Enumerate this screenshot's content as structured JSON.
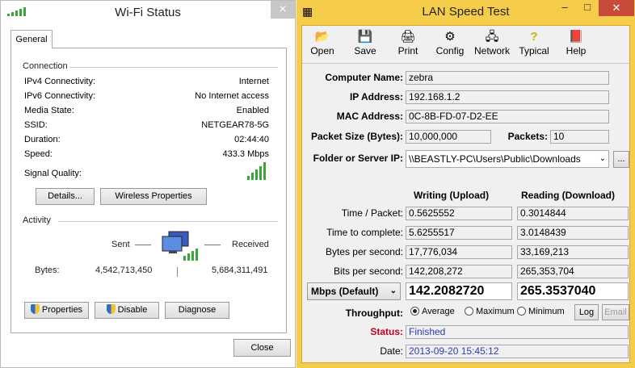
{
  "wifi": {
    "title": "Wi-Fi Status",
    "close_glyph": "×",
    "tab": "General",
    "connection": {
      "heading": "Connection",
      "rows": [
        {
          "label": "IPv4 Connectivity:",
          "value": "Internet"
        },
        {
          "label": "IPv6 Connectivity:",
          "value": "No Internet access"
        },
        {
          "label": "Media State:",
          "value": "Enabled"
        },
        {
          "label": "SSID:",
          "value": "NETGEAR78-5G"
        },
        {
          "label": "Duration:",
          "value": "02:44:40"
        },
        {
          "label": "Speed:",
          "value": "433.3 Mbps"
        }
      ],
      "signal_label": "Signal Quality:",
      "signal_bars": 5
    },
    "details_button": "Details...",
    "wireless_button": "Wireless Properties",
    "activity": {
      "heading": "Activity",
      "sent": "Sent",
      "received": "Received",
      "bytes_label": "Bytes:",
      "bytes_sent": "4,542,713,450",
      "bytes_received": "5,684,311,491"
    },
    "properties_button": "Properties",
    "disable_button": "Disable",
    "diagnose_button": "Diagnose",
    "close_button": "Close"
  },
  "lan": {
    "title": "LAN Speed Test",
    "controls": {
      "minimize": "–",
      "maximize": "□",
      "close": "✕"
    },
    "toolbar": [
      {
        "label": "Open",
        "icon": "folder-open-icon",
        "glyph": "📂"
      },
      {
        "label": "Save",
        "icon": "floppy-icon",
        "glyph": "💾"
      },
      {
        "label": "Print",
        "icon": "printer-icon",
        "glyph": "🖨"
      },
      {
        "label": "Config",
        "icon": "config-icon",
        "glyph": "⚙"
      },
      {
        "label": "Network",
        "icon": "network-icon",
        "glyph": "🖧"
      },
      {
        "label": "Typical",
        "icon": "question-icon",
        "glyph": "?"
      },
      {
        "label": "Help",
        "icon": "help-book-icon",
        "glyph": "📕"
      }
    ],
    "computer_name_label": "Computer Name:",
    "computer_name": "zebra",
    "ip_label": "IP Address:",
    "ip": "192.168.1.2",
    "mac_label": "MAC Address:",
    "mac": "0C-8B-FD-07-D2-EE",
    "packet_size_label": "Packet Size (Bytes):",
    "packet_size": "10,000,000",
    "packets_label": "Packets:",
    "packets": "10",
    "folder_label": "Folder or Server IP:",
    "folder": "\\\\BEASTLY-PC\\Users\\Public\\Downloads",
    "browse": "...",
    "writing_header": "Writing (Upload)",
    "reading_header": "Reading (Download)",
    "rows": [
      {
        "label": "Time / Packet:",
        "write": "0.5625552",
        "read": "0.3014844"
      },
      {
        "label": "Time to complete:",
        "write": "5.6255517",
        "read": "3.0148439"
      },
      {
        "label": "Bytes per second:",
        "write": "17,776,034",
        "read": "33,169,213"
      },
      {
        "label": "Bits per second:",
        "write": "142,208,272",
        "read": "265,353,704"
      }
    ],
    "unit_select": "Mbps (Default)",
    "mbps_write": "142.2082720",
    "mbps_read": "265.3537040",
    "throughput_label": "Throughput:",
    "throughput_options": [
      "Average",
      "Maximum",
      "Minimum"
    ],
    "throughput_selected": "Average",
    "log_button": "Log",
    "email_button": "Email",
    "status_label": "Status:",
    "status": "Finished",
    "date_label": "Date:",
    "date": "2013-09-20 15:45:12",
    "colors": {
      "title_bar": "#f6cd4a",
      "status_label": "#c0001e",
      "value_blue": "#2a3ab8"
    }
  }
}
